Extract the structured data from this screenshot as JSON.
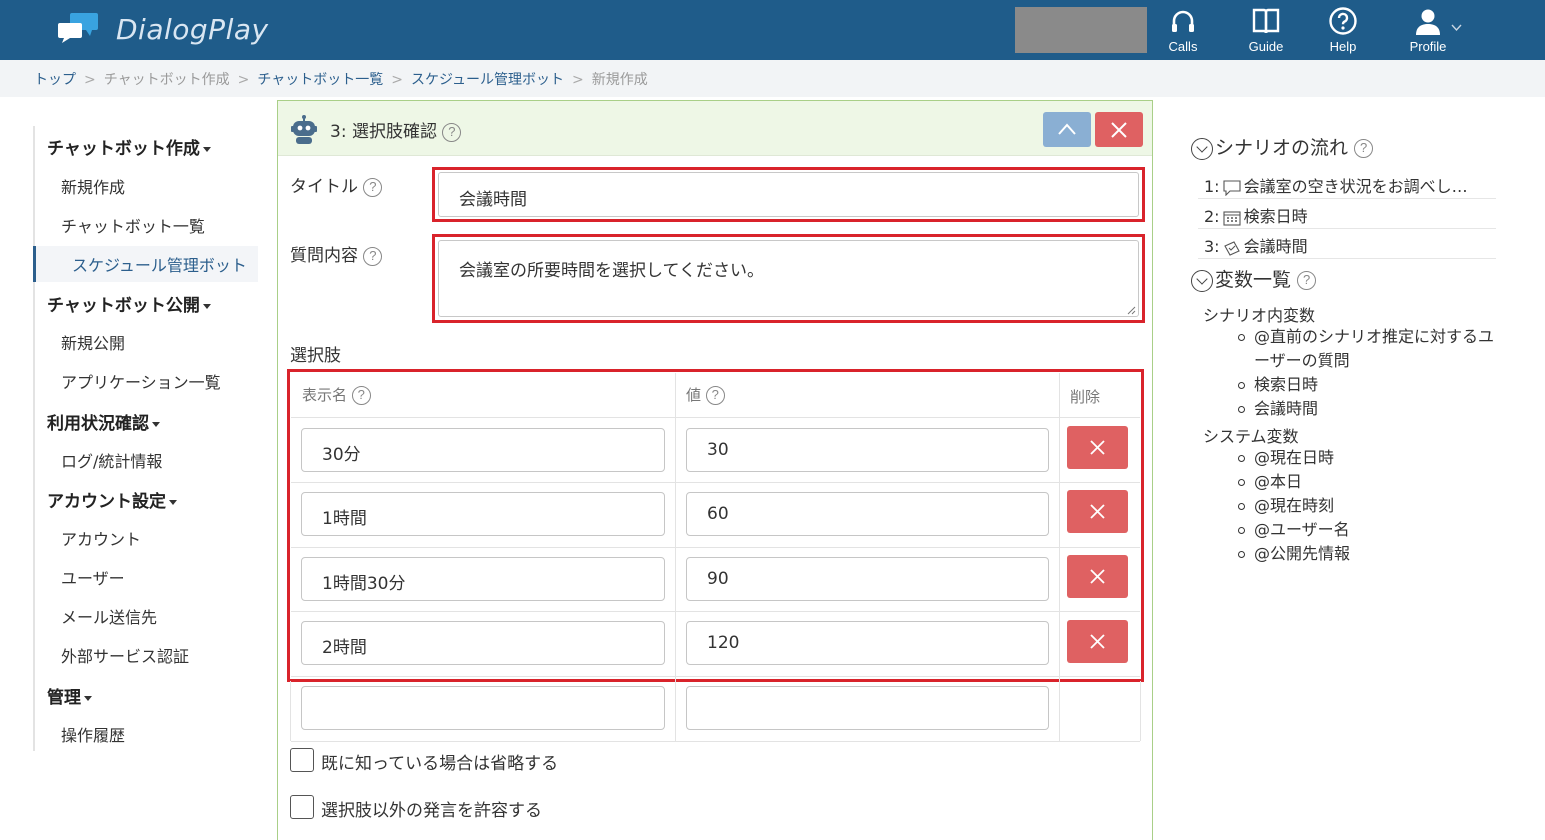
{
  "header": {
    "app_name": "DialogPlay",
    "nav": [
      {
        "label": "Calls",
        "icon": "headset-icon"
      },
      {
        "label": "Guide",
        "icon": "book-icon"
      },
      {
        "label": "Help",
        "icon": "help-circle-icon"
      },
      {
        "label": "Profile",
        "icon": "user-icon"
      }
    ],
    "brand_color": "#1f5c8a"
  },
  "breadcrumb": [
    "トップ",
    "チャットボット作成",
    "チャットボット一覧",
    "スケジュール管理ボット",
    "新規作成"
  ],
  "sidebar": {
    "sections": [
      {
        "title": "チャットボット作成",
        "items": [
          "新規作成",
          "チャットボット一覧",
          "スケジュール管理ボット"
        ]
      },
      {
        "title": "チャットボット公開",
        "items": [
          "新規公開",
          "アプリケーション一覧"
        ]
      },
      {
        "title": "利用状況確認",
        "items": [
          "ログ/統計情報"
        ]
      },
      {
        "title": "アカウント設定",
        "items": [
          "アカウント",
          "ユーザー",
          "メール送信先",
          "外部サービス認証"
        ]
      },
      {
        "title": "管理",
        "items": [
          "操作履歴"
        ]
      }
    ]
  },
  "panel": {
    "title": "3: 選択肢確認",
    "title_label": "タイトル",
    "title_value": "会議時間",
    "question_label": "質問内容",
    "question_value": "会議室の所要時間を選択してください。",
    "choices_label": "選択肢",
    "columns": {
      "display": "表示名",
      "value": "値",
      "delete": "削除"
    },
    "choices": [
      {
        "display": "30分",
        "value": "30"
      },
      {
        "display": "1時間",
        "value": "60"
      },
      {
        "display": "1時間30分",
        "value": "90"
      },
      {
        "display": "2時間",
        "value": "120"
      }
    ],
    "checkbox_skip": "既に知っている場合は省略する",
    "checkbox_allow": "選択肢以外の発言を許容する",
    "help_mark": "?"
  },
  "right": {
    "flow_title": "シナリオの流れ",
    "flow": [
      {
        "num": "1:",
        "icon": "speech-bubble-icon",
        "text": "会議室の空き状況をお調べし…"
      },
      {
        "num": "2:",
        "icon": "calendar-icon",
        "text": "検索日時"
      },
      {
        "num": "3:",
        "icon": "choice-icon",
        "text": "会議時間"
      }
    ],
    "vars_title": "変数一覧",
    "scenario_vars_label": "シナリオ内変数",
    "scenario_vars": [
      "@直前のシナリオ推定に対するユーザーの質問",
      "検索日時",
      "会議時間"
    ],
    "system_vars_label": "システム変数",
    "system_vars": [
      "@現在日時",
      "@本日",
      "@現在時刻",
      "@ユーザー名",
      "@公開先情報"
    ]
  }
}
